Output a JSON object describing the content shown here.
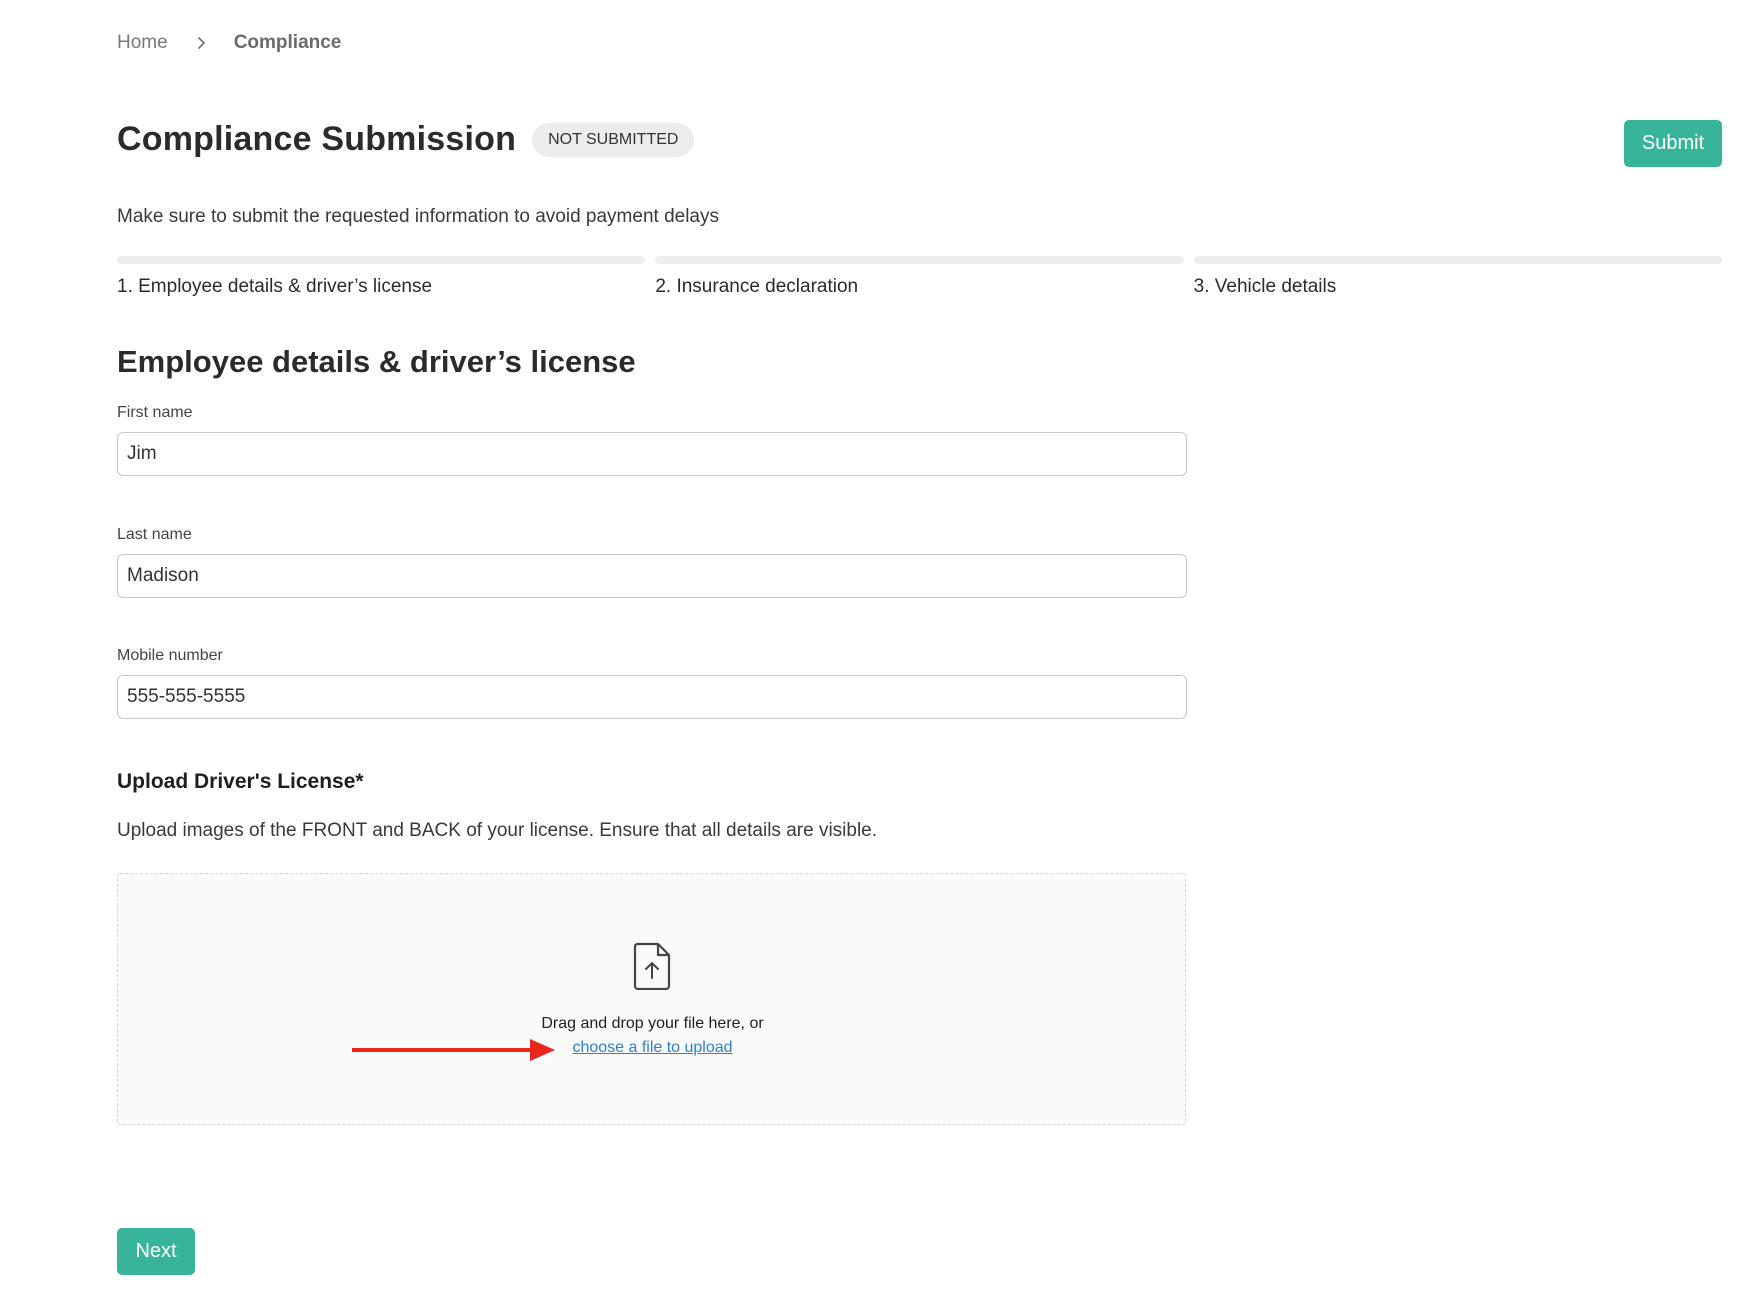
{
  "breadcrumb": {
    "home": "Home",
    "current": "Compliance"
  },
  "header": {
    "title": "Compliance Submission",
    "status": "NOT SUBMITTED",
    "submit_label": "Submit"
  },
  "subtitle": "Make sure to submit the requested information to avoid payment delays",
  "steps": [
    {
      "label": "1. Employee details & driver’s license"
    },
    {
      "label": "2. Insurance declaration"
    },
    {
      "label": "3. Vehicle details"
    }
  ],
  "section": {
    "title": "Employee details & driver’s license"
  },
  "form": {
    "first_name": {
      "label": "First name",
      "value": "Jim"
    },
    "last_name": {
      "label": "Last name",
      "value": "Madison"
    },
    "mobile": {
      "label": "Mobile number",
      "value": "555-555-5555"
    }
  },
  "upload": {
    "heading": "Upload Driver's License*",
    "description": "Upload images of the FRONT and BACK of your license. Ensure that all details are visible.",
    "drop_text": "Drag and drop your file here, or",
    "choose_link": "choose a file to upload"
  },
  "footer": {
    "next_label": "Next"
  },
  "colors": {
    "accent": "#38b49b",
    "link": "#2f80cf",
    "annotation": "#e8261a"
  },
  "icons": {
    "breadcrumb_separator": "chevron-right-icon",
    "upload": "file-upload-icon",
    "annotation": "arrow-right-icon"
  }
}
